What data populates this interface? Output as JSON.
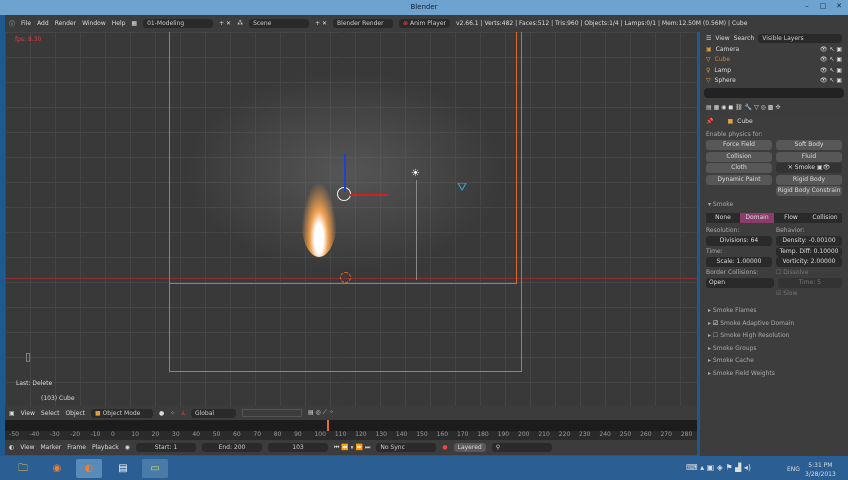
{
  "window": {
    "title": "Blender"
  },
  "info": {
    "menus": [
      "File",
      "Add",
      "Render",
      "Window",
      "Help"
    ],
    "layout": "01-Modeling",
    "scene": "Scene",
    "engine": "Blender Render",
    "anim_player": "Anim Player",
    "stats": "v2.66.1 | Verts:482 | Faces:512 | Tris:960 | Objects:1/4 | Lamps:0/1 | Mem:12.50M (0.56M) | Cube"
  },
  "viewport": {
    "fps": "fps: 8.30",
    "last_op": "Last: Delete",
    "object_label": "(103) Cube"
  },
  "view_header": {
    "menus": [
      "View",
      "Select",
      "Object"
    ],
    "mode": "Object Mode",
    "orientation": "Global"
  },
  "timeline": {
    "ticks": [
      "-50",
      "-40",
      "-30",
      "-20",
      "-10",
      "0",
      "10",
      "20",
      "30",
      "40",
      "50",
      "60",
      "70",
      "80",
      "90",
      "100",
      "110",
      "120",
      "130",
      "140",
      "150",
      "160",
      "170",
      "180",
      "190",
      "200",
      "210",
      "220",
      "230",
      "240",
      "250",
      "260",
      "270",
      "280"
    ],
    "current": 103,
    "range": [
      -50,
      280
    ]
  },
  "timeline_header": {
    "menus": [
      "View",
      "Marker",
      "Frame",
      "Playback"
    ],
    "start": "Start: 1",
    "end": "End: 200",
    "frame": "103",
    "sync": "No Sync",
    "keying": "Layered"
  },
  "outliner": {
    "menus": [
      "View",
      "Search"
    ],
    "filter": "Visible Layers",
    "items": [
      "Camera",
      "Cube",
      "Lamp",
      "Sphere"
    ]
  },
  "properties": {
    "context": "Cube",
    "enable_label": "Enable physics for:",
    "physics": [
      "Force Field",
      "Soft Body",
      "Collision",
      "Fluid",
      "Cloth",
      "Smoke",
      "Dynamic Paint",
      "Rigid Body",
      "Rigid Body Constrain"
    ],
    "smoke_panel": "Smoke",
    "smoke_types": [
      "None",
      "Domain",
      "Flow",
      "Collision"
    ],
    "active_type": "Domain",
    "resolution_label": "Resolution:",
    "divisions": "Divisions: 64",
    "behavior_label": "Behavior:",
    "density": "Density: -0.00100",
    "temp_diff": "Temp. Diff: 0.10000",
    "time_label": "Time:",
    "scale": "Scale: 1.00000",
    "vorticity": "Vorticity: 2.00000",
    "border_label": "Border Collisions:",
    "border_value": "Open",
    "dissolve": "Dissolve",
    "dissolve_time": "Time: 5",
    "slow": "Slow",
    "subpanels": [
      "Smoke Flames",
      "Smoke Adaptive Domain",
      "Smoke High Resolution",
      "Smoke Groups",
      "Smoke Cache",
      "Smoke Field Weights"
    ]
  },
  "taskbar": {
    "language": "ENG",
    "time": "5:31 PM",
    "date": "3/28/2013"
  },
  "colors": {
    "accent": "#d86a2a",
    "active_tab": "#8c3c6c",
    "taskbar": "#2b5f93"
  }
}
